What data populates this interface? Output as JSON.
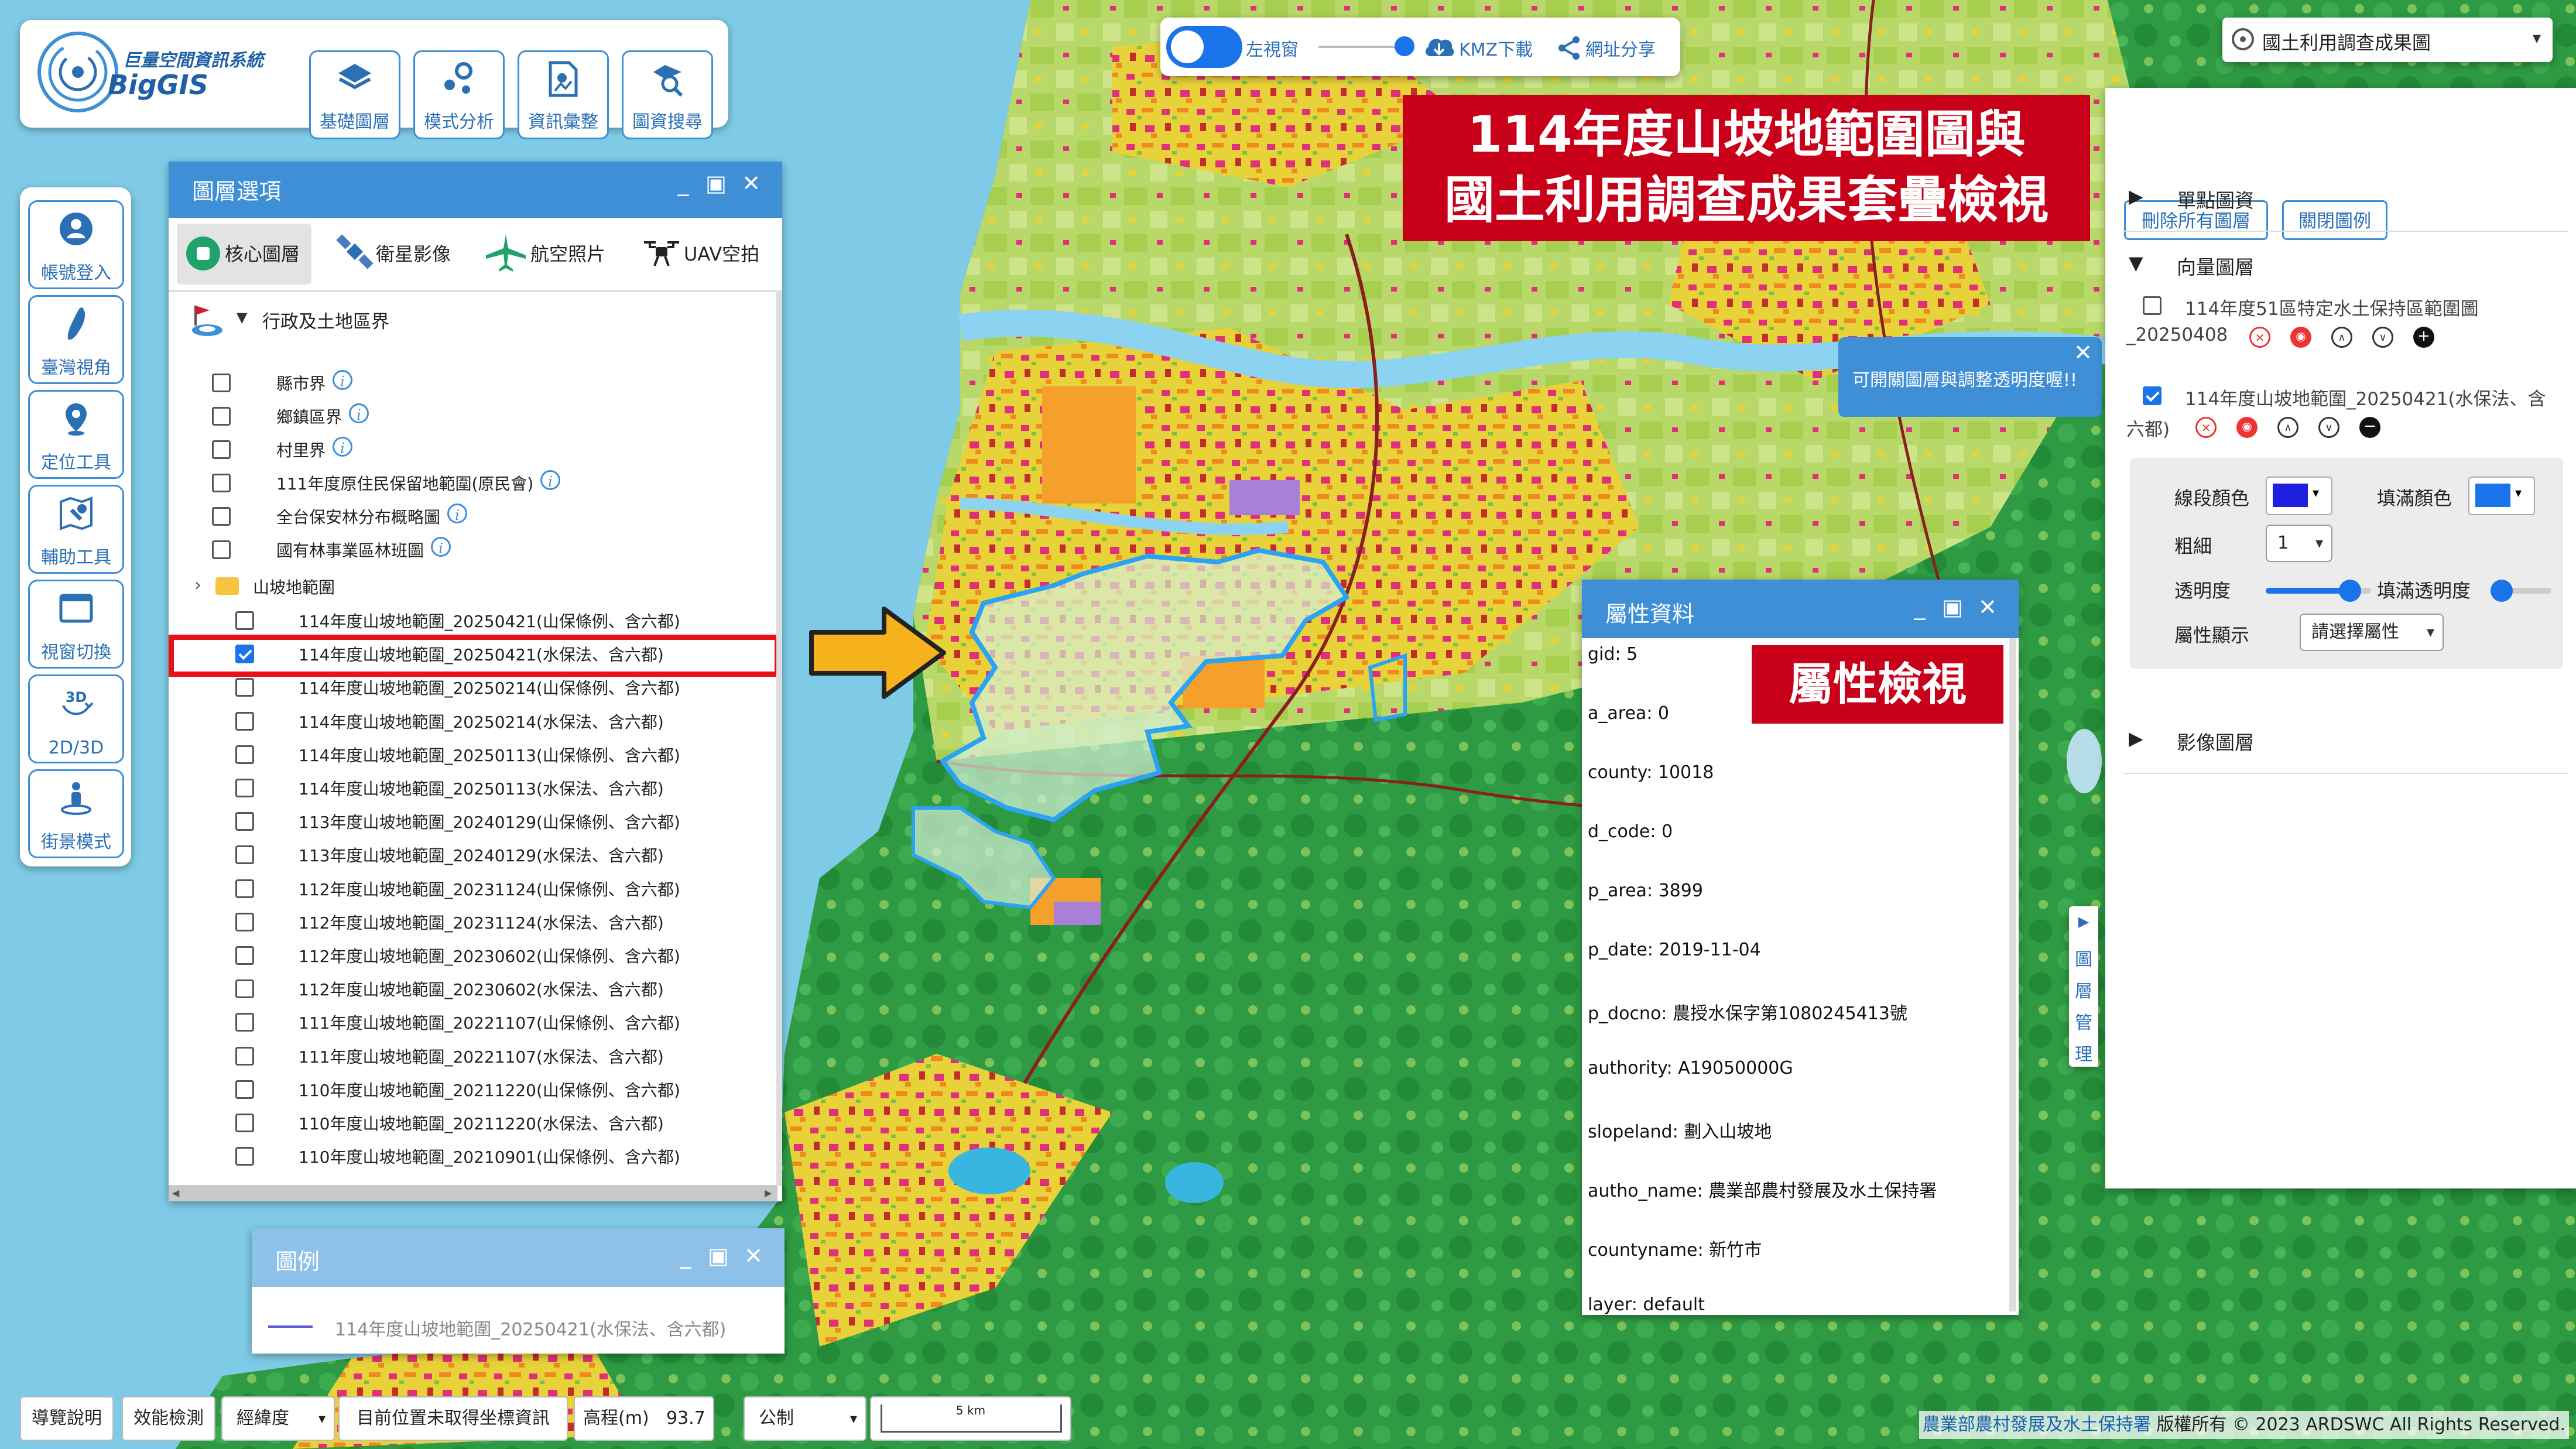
{
  "app": {
    "logo_title": "巨量空間資訊系統",
    "logo_name": "BigGIS"
  },
  "top_tools": [
    {
      "label": "基礎圖層",
      "icon": "layers-icon"
    },
    {
      "label": "模式分析",
      "icon": "analysis-icon"
    },
    {
      "label": "資訊彙整",
      "icon": "info-summary-icon"
    },
    {
      "label": "圖資搜尋",
      "icon": "map-search-icon"
    }
  ],
  "side_tools": [
    {
      "label": "帳號登入",
      "icon": "user-icon"
    },
    {
      "label": "臺灣視角",
      "icon": "taiwan-icon"
    },
    {
      "label": "定位工具",
      "icon": "location-pin-icon"
    },
    {
      "label": "輔助工具",
      "icon": "map-tool-icon"
    },
    {
      "label": "視窗切換",
      "icon": "window-icon"
    },
    {
      "label": "2D/3D",
      "icon": "3d-icon",
      "badge": "3D"
    },
    {
      "label": "街景模式",
      "icon": "street-view-icon"
    }
  ],
  "map_toolbar": {
    "left_view": "左視窗",
    "kmz": "KMZ下載",
    "share": "網址分享"
  },
  "basemap_select": "國土利用調查成果圖",
  "banner": {
    "line1": "114年度山坡地範圍圖與",
    "line2": "國土利用調查成果套疊檢視"
  },
  "attr_banner": "屬性檢視",
  "tooltip": "可開關圖層與調整透明度喔!!",
  "layer_panel": {
    "title": "圖層選項",
    "tabs": [
      {
        "label": "核心圖層",
        "icon": "core-layer-icon"
      },
      {
        "label": "衛星影像",
        "icon": "satellite-icon"
      },
      {
        "label": "航空照片",
        "icon": "airplane-icon"
      },
      {
        "label": "UAV空拍",
        "icon": "drone-icon"
      }
    ],
    "group": "行政及土地區界",
    "items": [
      {
        "label": "縣市界",
        "checked": false,
        "info": true
      },
      {
        "label": "鄉鎮區界",
        "checked": false,
        "info": true
      },
      {
        "label": "村里界",
        "checked": false,
        "info": true
      },
      {
        "label": "111年度原住民保留地範圍(原民會)",
        "checked": false,
        "info": true
      },
      {
        "label": "全台保安林分布概略圖",
        "checked": false,
        "info": true
      },
      {
        "label": "國有林事業區林班圖",
        "checked": false,
        "info": true
      }
    ],
    "subgroup": "山坡地範圍",
    "sub_items": [
      {
        "label": "114年度山坡地範圍_20250421(山保條例、含六都)",
        "checked": false
      },
      {
        "label": "114年度山坡地範圍_20250421(水保法、含六都)",
        "checked": true
      },
      {
        "label": "114年度山坡地範圍_20250214(山保條例、含六都)",
        "checked": false
      },
      {
        "label": "114年度山坡地範圍_20250214(水保法、含六都)",
        "checked": false
      },
      {
        "label": "114年度山坡地範圍_20250113(山保條例、含六都)",
        "checked": false
      },
      {
        "label": "114年度山坡地範圍_20250113(水保法、含六都)",
        "checked": false
      },
      {
        "label": "113年度山坡地範圍_20240129(山保條例、含六都)",
        "checked": false
      },
      {
        "label": "113年度山坡地範圍_20240129(水保法、含六都)",
        "checked": false
      },
      {
        "label": "112年度山坡地範圍_20231124(山保條例、含六都)",
        "checked": false
      },
      {
        "label": "112年度山坡地範圍_20231124(水保法、含六都)",
        "checked": false
      },
      {
        "label": "112年度山坡地範圍_20230602(山保條例、含六都)",
        "checked": false
      },
      {
        "label": "112年度山坡地範圍_20230602(水保法、含六都)",
        "checked": false
      },
      {
        "label": "111年度山坡地範圍_20221107(山保條例、含六都)",
        "checked": false
      },
      {
        "label": "111年度山坡地範圍_20221107(水保法、含六都)",
        "checked": false
      },
      {
        "label": "110年度山坡地範圍_20211220(山保條例、含六都)",
        "checked": false
      },
      {
        "label": "110年度山坡地範圍_20211220(水保法、含六都)",
        "checked": false
      },
      {
        "label": "110年度山坡地範圍_20210901(山保條例、含六都)",
        "checked": false
      }
    ]
  },
  "legend_panel": {
    "title": "圖例",
    "item": "114年度山坡地範圍_20250421(水保法、含六都)",
    "line_color": "#5b5bd6"
  },
  "attr_panel": {
    "title": "屬性資料",
    "rows": [
      "gid: 5",
      "a_area: 0",
      "county: 10018",
      "d_code: 0",
      "p_area: 3899",
      "p_date: 2019-11-04",
      "p_docno: 農授水保字第1080245413號",
      "authority: A19050000G",
      "slopeland: 劃入山坡地",
      "autho_name: 農業部農村發展及水土保持署",
      "countyname: 新竹市",
      "layer: default"
    ]
  },
  "right_panel": {
    "delete_all": "刪除所有圖層",
    "close_legend": "關閉圖例",
    "sec_point": "單點圖資",
    "sec_vector": "向量圖層",
    "vec1_line1": "114年度51區特定水土保持區範圍圖",
    "vec1_line2": "_20250408",
    "vec2_line1": "114年度山坡地範圍_20250421(水保法、含",
    "vec2_line2": "六都)",
    "line_color_label": "線段顏色",
    "fill_color_label": "填滿顏色",
    "width_label": "粗細",
    "width_value": "1",
    "opacity_label": "透明度",
    "fill_opacity_label": "填滿透明度",
    "attr_display_label": "屬性顯示",
    "attr_display_value": "請選擇屬性",
    "sec_image": "影像圖層",
    "line_color": "#1f1fe0",
    "fill_color": "#1a73e8",
    "opacity_level": 0.8,
    "fill_opacity_level": 0.15
  },
  "layer_mgmt_tab": [
    "▶",
    "圖",
    "層",
    "管",
    "理"
  ],
  "bottom_bar": {
    "guide": "導覽說明",
    "perf": "效能檢測",
    "coord_type": "經緯度",
    "position": "目前位置未取得坐標資訊",
    "elev_label": "高程(m)",
    "elev_value": "93.7",
    "unit": "公制",
    "scale": "5 km"
  },
  "copyright_org": "農業部農村發展及水土保持署",
  "copyright": " 版權所有 © 2023 ARDSWC All Rights Reserved."
}
